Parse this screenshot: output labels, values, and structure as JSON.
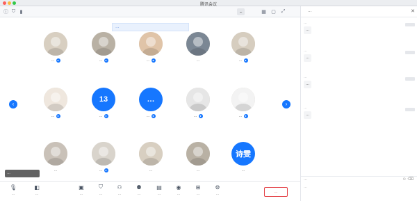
{
  "window": {
    "title": "腾讯会议"
  },
  "meeting_bar": {
    "timer": "…"
  },
  "stage": {
    "banner": "…",
    "float_chip": "…",
    "participants": [
      {
        "name": "…",
        "type": "image",
        "mic": true
      },
      {
        "name": "…",
        "type": "image",
        "mic": true
      },
      {
        "name": "…",
        "type": "image",
        "mic": true
      },
      {
        "name": "…",
        "type": "image",
        "mic": false
      },
      {
        "name": "…",
        "type": "image",
        "mic": true
      },
      {
        "name": "…",
        "type": "image",
        "mic": true
      },
      {
        "name": "…",
        "type": "text",
        "avatar_text": "13",
        "mic": true
      },
      {
        "name": "…",
        "type": "text",
        "avatar_text": "…",
        "mic": true
      },
      {
        "name": "…",
        "type": "image",
        "mic": true
      },
      {
        "name": "…",
        "type": "image",
        "mic": true
      },
      {
        "name": "…",
        "type": "image",
        "mic": false
      },
      {
        "name": "…",
        "type": "image",
        "mic": true
      },
      {
        "name": "…",
        "type": "image",
        "mic": false
      },
      {
        "name": "…",
        "type": "image",
        "mic": false
      },
      {
        "name": "…",
        "type": "text",
        "avatar_text": "诗雯",
        "mic": false
      }
    ]
  },
  "toolbar": {
    "buttons": [
      {
        "label": "…",
        "icon": "microphone-icon"
      },
      {
        "label": "…",
        "icon": "camera-icon"
      },
      {
        "label": "…",
        "icon": "screen-share-icon"
      },
      {
        "label": "…",
        "icon": "shield-icon"
      },
      {
        "label": "…",
        "icon": "invite-icon"
      },
      {
        "label": "…",
        "icon": "members-icon"
      },
      {
        "label": "…",
        "icon": "chat-icon"
      },
      {
        "label": "…",
        "icon": "record-icon"
      },
      {
        "label": "…",
        "icon": "apps-icon"
      },
      {
        "label": "…",
        "icon": "settings-icon"
      }
    ],
    "end_label": "…"
  },
  "panel": {
    "title": "…",
    "close_glyph": "✕",
    "messages": [
      {
        "meta": "…",
        "text": "…"
      },
      {
        "meta": "…",
        "text": "…"
      },
      {
        "meta": "…",
        "text": "…"
      },
      {
        "meta": "…",
        "text": "…"
      }
    ],
    "tools_label": "…",
    "input_placeholder": "…"
  },
  "colors": {
    "accent": "#1677ff",
    "end": "#e5484d",
    "panel_bg": "#ffffff"
  }
}
